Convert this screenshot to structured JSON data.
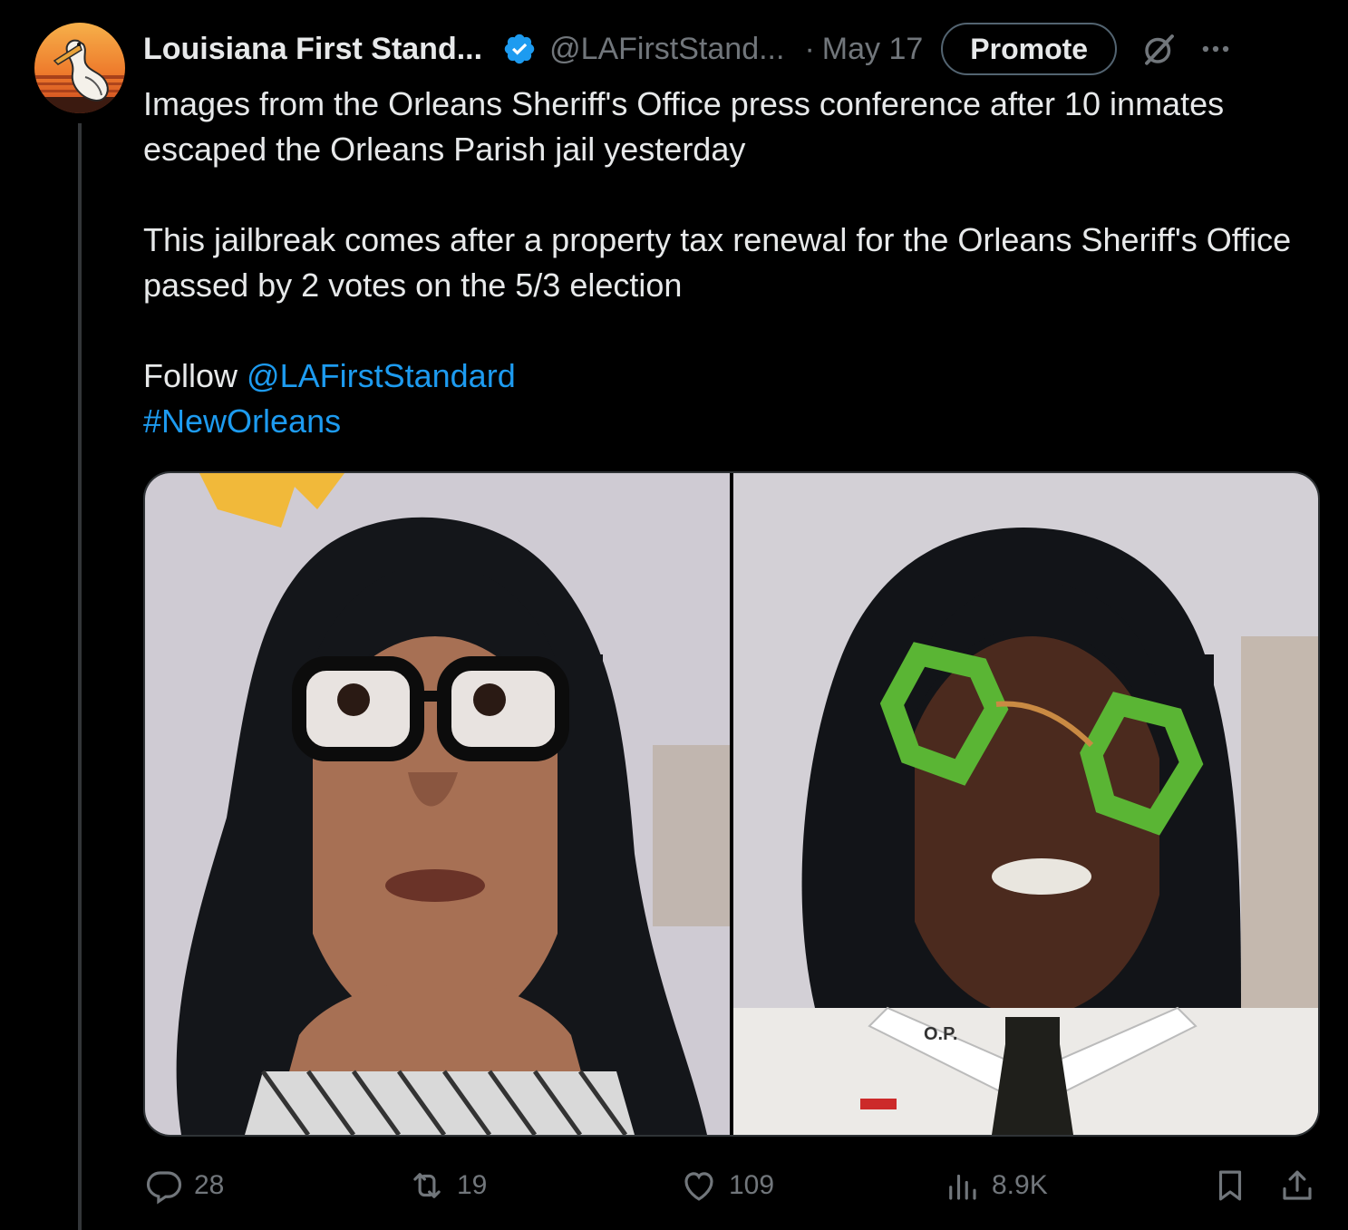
{
  "author": {
    "display_name": "Louisiana First Stand...",
    "handle": "@LAFirstStand...",
    "dot": "·",
    "date": "May 17",
    "avatar_icon": "pelican-sunset-avatar",
    "verified_icon": "verified-badge-icon"
  },
  "header_actions": {
    "promote_label": "Promote",
    "grok_icon": "grok-icon",
    "more_icon": "more-icon"
  },
  "tweet": {
    "line1": "Images from the Orleans Sheriff's Office press conference after 10 inmates escaped the Orleans Parish jail yesterday",
    "line2": "This jailbreak comes after a property tax renewal for the Orleans Sheriff's Office passed by 2 votes on the 5/3 election",
    "follow_prefix": "Follow",
    "mention": "@LAFirstStandard",
    "hashtag": "#NewOrleans"
  },
  "media": {
    "count": 2
  },
  "stats": {
    "replies": "28",
    "reposts": "19",
    "likes": "109",
    "views": "8.9K"
  },
  "colors": {
    "background": "#000000",
    "text": "#e7e9ea",
    "muted": "#71767b",
    "link": "#1d9bf0",
    "verified": "#1d9bf0"
  }
}
